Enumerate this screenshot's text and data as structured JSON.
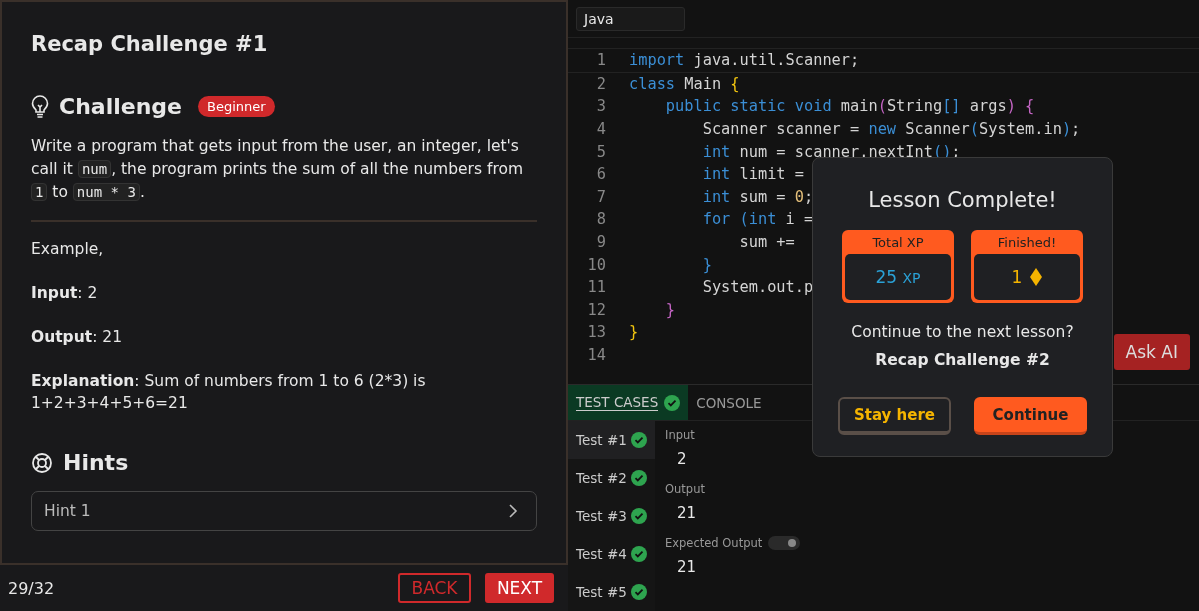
{
  "lesson": {
    "title": "Recap Challenge #1",
    "challenge_heading": "Challenge",
    "level_badge": "Beginner",
    "description": [
      {
        "kind": "text",
        "t": "Write a program that gets input from the user, an integer, let's call it "
      },
      {
        "kind": "code",
        "t": "num"
      },
      {
        "kind": "text",
        "t": ", the program prints the sum of all the numbers from "
      },
      {
        "kind": "code",
        "t": "1"
      },
      {
        "kind": "text",
        "t": " to "
      },
      {
        "kind": "code",
        "t": "num * 3"
      },
      {
        "kind": "text",
        "t": "."
      }
    ],
    "example": [
      "Example,",
      "**Input**: 2",
      "**Output**: 21",
      "**Explanation**: Sum of numbers from 1 to 6 (2*3) is 1+2+3+4+5+6=21"
    ],
    "hints_heading": "Hints",
    "hints": [
      "Hint 1"
    ]
  },
  "footer": {
    "progress": "29/32",
    "back": "BACK",
    "next": "NEXT"
  },
  "editor": {
    "language": "Java",
    "ask_ai": "Ask AI",
    "lines": [
      {
        "n": "1",
        "tokens": [
          {
            "kind": "kw",
            "t": "import"
          },
          {
            "kind": "plain",
            "t": " java.util.Scanner;"
          }
        ]
      },
      {
        "n": "2",
        "tokens": [
          {
            "kind": "kw",
            "t": "class"
          },
          {
            "kind": "plain",
            "t": " Main "
          },
          {
            "kind": "b1",
            "t": "{"
          }
        ]
      },
      {
        "n": "3",
        "tokens": [
          {
            "kind": "kw",
            "t": "    public static void"
          },
          {
            "kind": "plain",
            "t": " main"
          },
          {
            "kind": "b2",
            "t": "("
          },
          {
            "kind": "plain",
            "t": "String"
          },
          {
            "kind": "b3",
            "t": "[]"
          },
          {
            "kind": "plain",
            "t": " args"
          },
          {
            "kind": "b2",
            "t": ")"
          },
          {
            "kind": "b2",
            "t": " {"
          }
        ]
      },
      {
        "n": "4",
        "tokens": [
          {
            "kind": "plain",
            "t": "        Scanner scanner = "
          },
          {
            "kind": "kw",
            "t": "new"
          },
          {
            "kind": "plain",
            "t": " Scanner"
          },
          {
            "kind": "b3",
            "t": "("
          },
          {
            "kind": "plain",
            "t": "System.in"
          },
          {
            "kind": "b3",
            "t": ")"
          },
          {
            "kind": "plain",
            "t": ";"
          }
        ]
      },
      {
        "n": "5",
        "tokens": [
          {
            "kind": "kw",
            "t": "        int"
          },
          {
            "kind": "plain",
            "t": " num = scanner.nextInt"
          },
          {
            "kind": "b3",
            "t": "()"
          },
          {
            "kind": "plain",
            "t": ";"
          }
        ]
      },
      {
        "n": "6",
        "tokens": [
          {
            "kind": "kw",
            "t": "        int"
          },
          {
            "kind": "plain",
            "t": " limit ="
          }
        ]
      },
      {
        "n": "7",
        "tokens": [
          {
            "kind": "kw",
            "t": "        int"
          },
          {
            "kind": "plain",
            "t": " sum = "
          },
          {
            "kind": "num",
            "t": "0"
          },
          {
            "kind": "plain",
            "t": ";"
          }
        ]
      },
      {
        "n": "8",
        "tokens": [
          {
            "kind": "kw",
            "t": "        for"
          },
          {
            "kind": "b3",
            "t": " ("
          },
          {
            "kind": "kw",
            "t": "int"
          },
          {
            "kind": "plain",
            "t": " i ="
          }
        ]
      },
      {
        "n": "9",
        "tokens": [
          {
            "kind": "plain",
            "t": "            sum +="
          }
        ]
      },
      {
        "n": "10",
        "tokens": [
          {
            "kind": "b3",
            "t": "        }"
          }
        ]
      },
      {
        "n": "11",
        "tokens": [
          {
            "kind": "plain",
            "t": "        System.out.p"
          }
        ]
      },
      {
        "n": "12",
        "tokens": [
          {
            "kind": "b2",
            "t": "    }"
          }
        ]
      },
      {
        "n": "13",
        "tokens": [
          {
            "kind": "b1",
            "t": "}"
          }
        ]
      },
      {
        "n": "14"
      }
    ]
  },
  "panel_tabs": [
    {
      "label": "TEST CASES",
      "selected": true,
      "passed": true
    },
    {
      "label": "CONSOLE",
      "selected": false,
      "passed": false
    }
  ],
  "tests": [
    {
      "label": "Test #1",
      "selected": true,
      "passed": true
    },
    {
      "label": "Test #2",
      "selected": false,
      "passed": true
    },
    {
      "label": "Test #3",
      "selected": false,
      "passed": true
    },
    {
      "label": "Test #4",
      "selected": false,
      "passed": true
    },
    {
      "label": "Test #5",
      "selected": false,
      "passed": true
    }
  ],
  "test_detail": {
    "input_label": "Input",
    "input": "2",
    "output_label": "Output",
    "output": "21",
    "expected_label": "Expected Output",
    "expected_toggle_on": true,
    "expected": "21"
  },
  "modal": {
    "title": "Lesson Complete!",
    "cards": [
      {
        "kind": "xp",
        "header": "Total XP",
        "value": "25",
        "unit": "XP"
      },
      {
        "kind": "gems",
        "header": "Finished!",
        "value": "1"
      }
    ],
    "question": "Continue to the next lesson?",
    "next_lesson": "Recap Challenge #2",
    "stay": "Stay here",
    "continue": "Continue"
  }
}
